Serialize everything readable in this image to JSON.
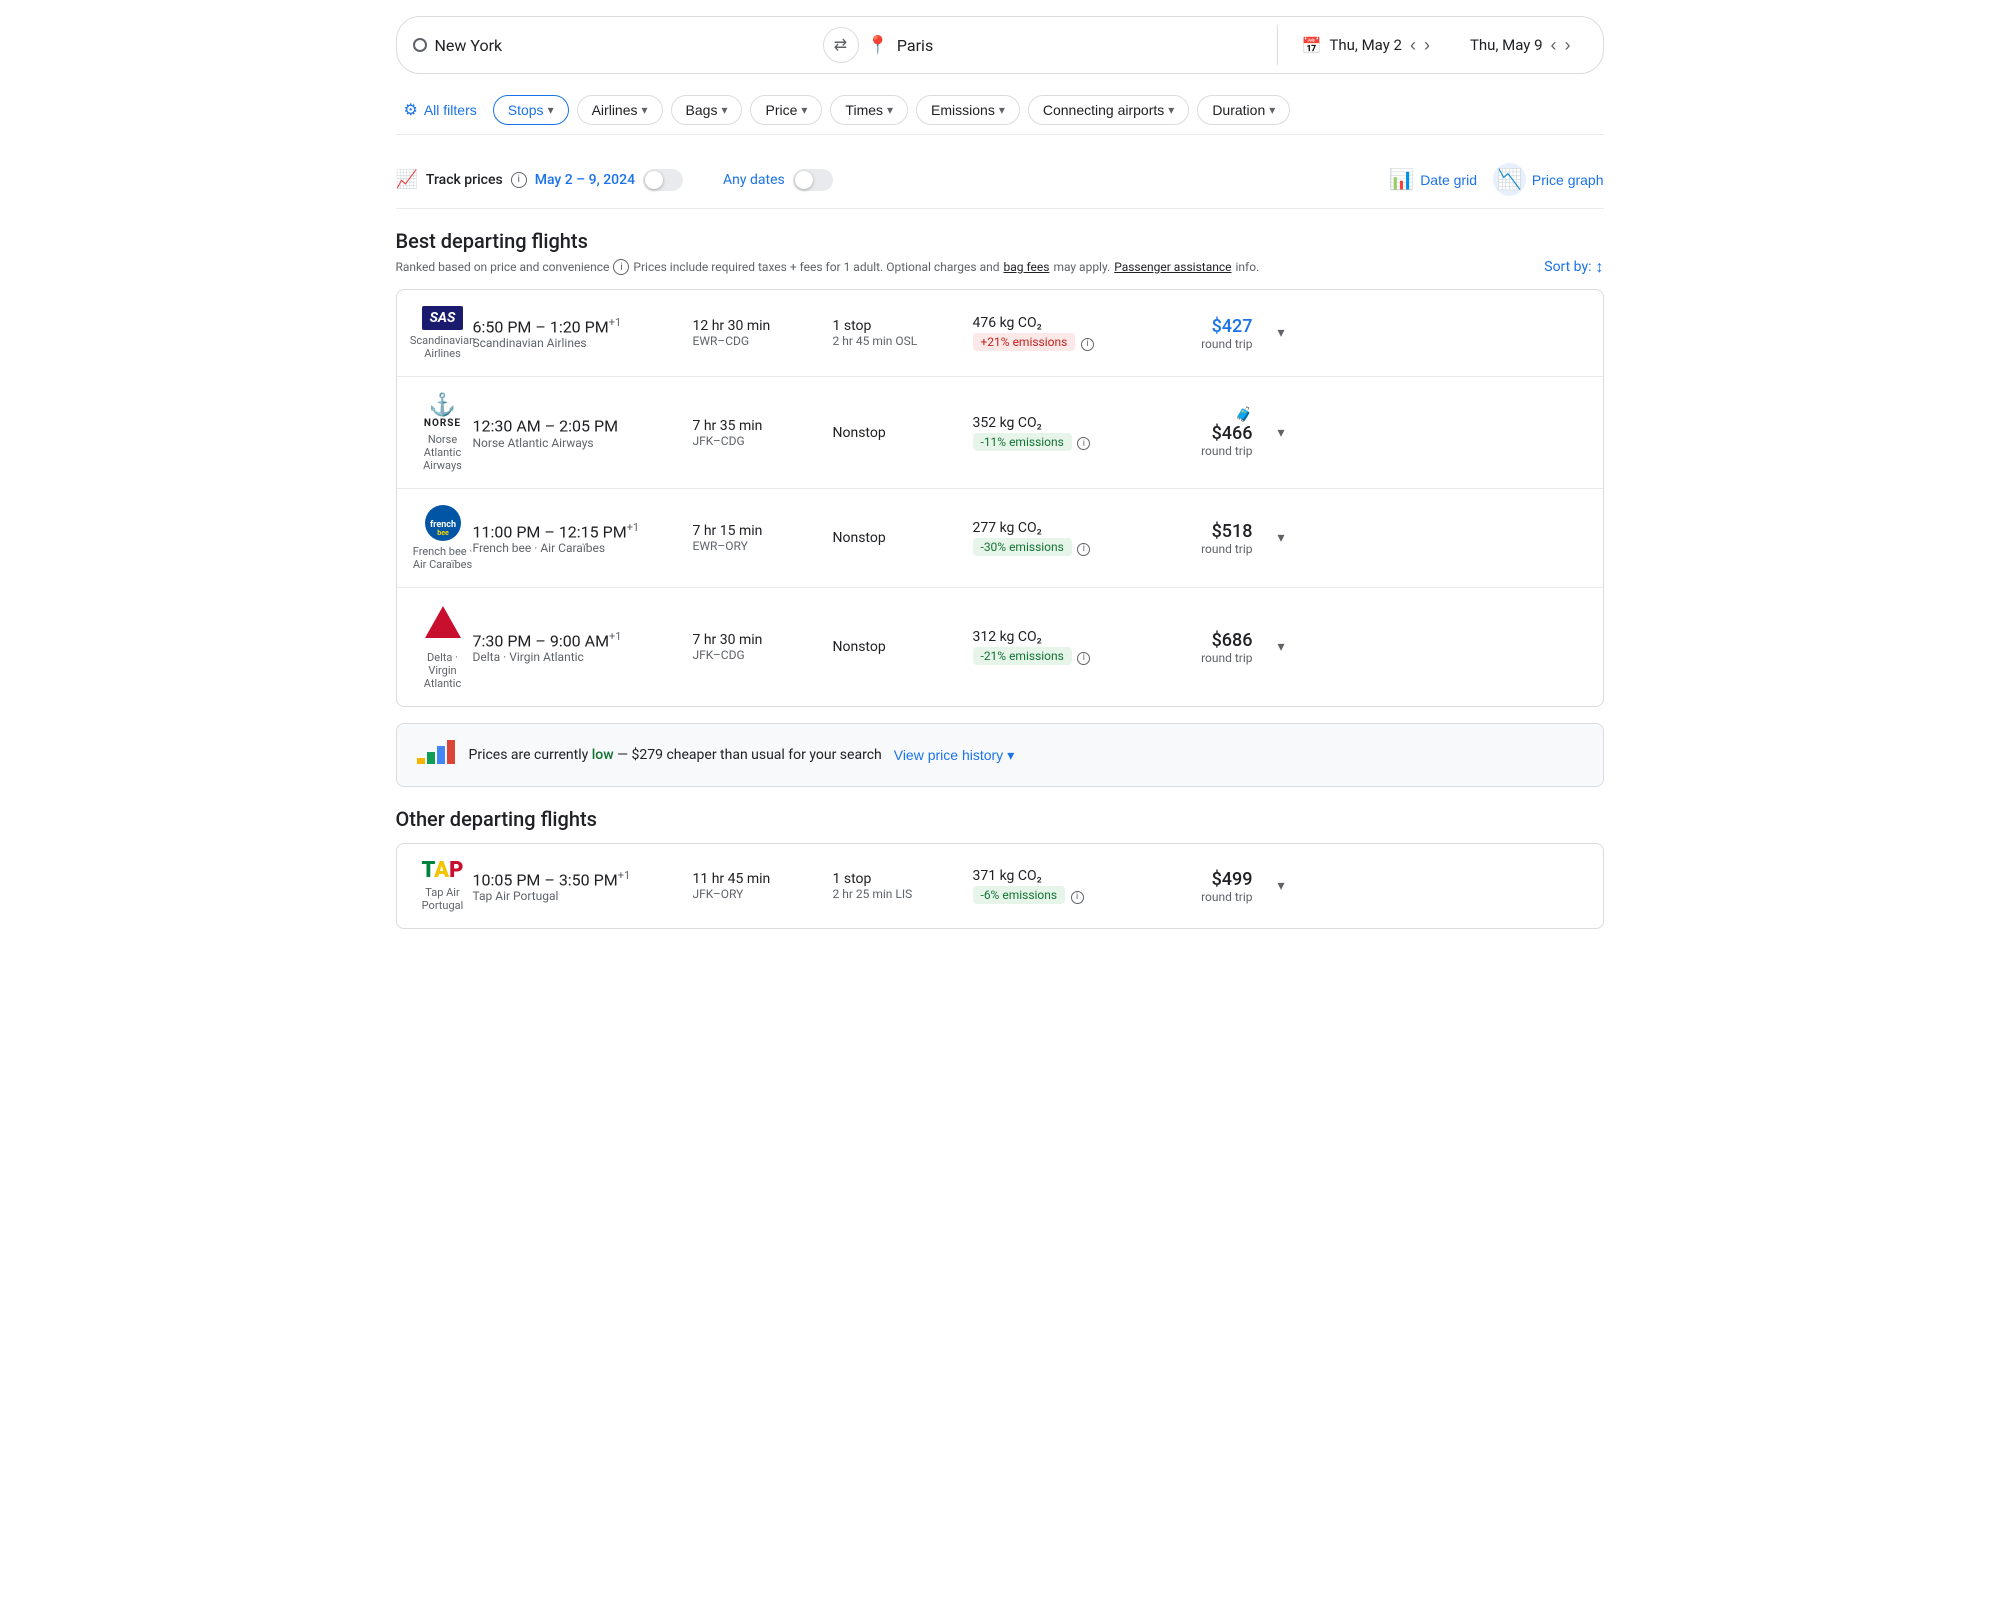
{
  "searchBar": {
    "origin": "New York",
    "destination": "Paris",
    "dateFrom": "Thu, May 2",
    "dateTo": "Thu, May 9",
    "swapLabel": "⇄"
  },
  "filters": {
    "allFilters": "All filters",
    "stops": "Stops",
    "airlines": "Airlines",
    "bags": "Bags",
    "price": "Price",
    "times": "Times",
    "emissions": "Emissions",
    "connectingAirports": "Connecting airports",
    "duration": "Duration"
  },
  "trackPrices": {
    "label": "Track prices",
    "dates": "May 2 – 9, 2024",
    "anyDates": "Any dates",
    "dateGrid": "Date grid",
    "priceGraph": "Price graph"
  },
  "bestFlights": {
    "title": "Best departing flights",
    "subtitle": "Ranked based on price and convenience",
    "priceNote": "Prices include required taxes + fees for 1 adult. Optional charges and",
    "bagFees": "bag fees",
    "mayApply": "may apply.",
    "passengerAssistance": "Passenger assistance",
    "info": "info.",
    "sortBy": "Sort by:",
    "flights": [
      {
        "airline": "SAS",
        "airlineName": "Scandinavian Airlines",
        "timeRange": "6:50 PM – 1:20 PM",
        "timeSuffix": "+1",
        "duration": "12 hr 30 min",
        "route": "EWR–CDG",
        "stops": "1 stop",
        "stopDetail": "2 hr 45 min OSL",
        "emissions": "476 kg CO₂",
        "emissionsBadge": "+21% emissions",
        "emissionsType": "negative",
        "price": "$427",
        "priceColor": "blue",
        "priceType": "round trip",
        "hasLuggage": false
      },
      {
        "airline": "NORSE",
        "airlineName": "Norse Atlantic Airways",
        "timeRange": "12:30 AM – 2:05 PM",
        "timeSuffix": "",
        "duration": "7 hr 35 min",
        "route": "JFK–CDG",
        "stops": "Nonstop",
        "stopDetail": "",
        "emissions": "352 kg CO₂",
        "emissionsBadge": "-11% emissions",
        "emissionsType": "positive",
        "price": "$466",
        "priceColor": "black",
        "priceType": "round trip",
        "hasLuggage": true
      },
      {
        "airline": "FRENCHBEE",
        "airlineName": "French bee · Air Caraïbes",
        "timeRange": "11:00 PM – 12:15 PM",
        "timeSuffix": "+1",
        "duration": "7 hr 15 min",
        "route": "EWR–ORY",
        "stops": "Nonstop",
        "stopDetail": "",
        "emissions": "277 kg CO₂",
        "emissionsBadge": "-30% emissions",
        "emissionsType": "positive",
        "price": "$518",
        "priceColor": "black",
        "priceType": "round trip",
        "hasLuggage": false
      },
      {
        "airline": "DELTA",
        "airlineName": "Delta · Virgin Atlantic",
        "timeRange": "7:30 PM – 9:00 AM",
        "timeSuffix": "+1",
        "duration": "7 hr 30 min",
        "route": "JFK–CDG",
        "stops": "Nonstop",
        "stopDetail": "",
        "emissions": "312 kg CO₂",
        "emissionsBadge": "-21% emissions",
        "emissionsType": "positive",
        "price": "$686",
        "priceColor": "black",
        "priceType": "round trip",
        "hasLuggage": false
      }
    ]
  },
  "priceBanner": {
    "text1": "Prices are currently",
    "lowText": "low",
    "text2": "— $279 cheaper than usual for your search",
    "viewHistory": "View price history"
  },
  "otherFlights": {
    "title": "Other departing flights",
    "flights": [
      {
        "airline": "TAP",
        "airlineName": "Tap Air Portugal",
        "timeRange": "10:05 PM – 3:50 PM",
        "timeSuffix": "+1",
        "duration": "11 hr 45 min",
        "route": "JFK–ORY",
        "stops": "1 stop",
        "stopDetail": "2 hr 25 min LIS",
        "emissions": "371 kg CO₂",
        "emissionsBadge": "-6% emissions",
        "emissionsType": "positive",
        "price": "$499",
        "priceColor": "black",
        "priceType": "round trip",
        "hasLuggage": false
      }
    ]
  }
}
